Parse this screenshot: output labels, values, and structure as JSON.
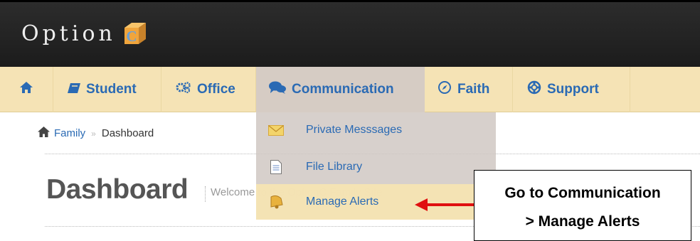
{
  "header": {
    "logo_text": "Option",
    "logo_badge": "C"
  },
  "nav": {
    "home_icon": "home-icon",
    "items": [
      {
        "label": "Student",
        "icon": "book-icon"
      },
      {
        "label": "Office",
        "icon": "gears-icon"
      },
      {
        "label": "Communication",
        "icon": "chat-icon"
      },
      {
        "label": "Faith",
        "icon": "compass-icon"
      },
      {
        "label": "Support",
        "icon": "lifebuoy-icon"
      }
    ],
    "active": "Communication"
  },
  "breadcrumb": {
    "family": "Family",
    "separator": "»",
    "current": "Dashboard"
  },
  "page": {
    "title": "Dashboard",
    "welcome": "Welcome to the OptionC Family Site"
  },
  "dropdown": {
    "items": [
      {
        "label": "Private Messsages",
        "icon": "envelope-icon"
      },
      {
        "label": "File Library",
        "icon": "document-icon"
      },
      {
        "label": "Manage Alerts",
        "icon": "bell-icon"
      }
    ],
    "highlighted": "Manage Alerts"
  },
  "callout": {
    "line1": "Go to Communication",
    "line2": "> Manage Alerts"
  },
  "colors": {
    "nav_bg": "#f5e3b5",
    "link": "#2a6ab4",
    "arrow": "#e01010"
  }
}
